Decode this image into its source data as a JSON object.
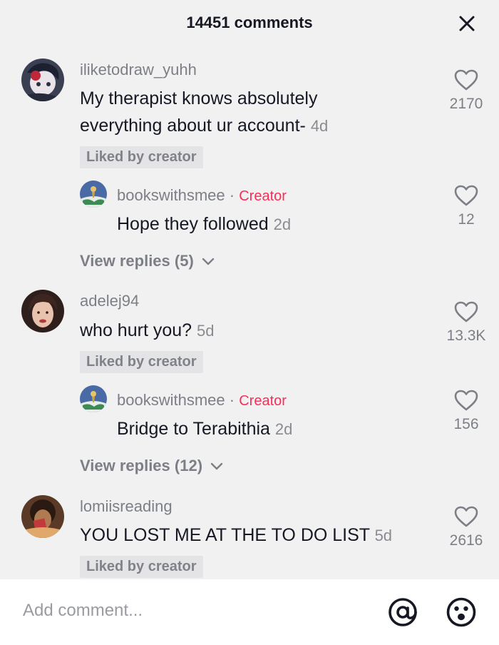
{
  "header": {
    "title": "14451 comments",
    "close_icon": "close-icon"
  },
  "comments": [
    {
      "username": "iliketodraw_yuhh",
      "text_line1": "My therapist knows absolutely",
      "text_line2": "everything about ur account-",
      "time": "4d",
      "liked_by_creator": "Liked by creator",
      "likes": "2170",
      "reply": {
        "username": "bookswithsmee",
        "separator": "·",
        "creator_tag": "Creator",
        "text": "Hope they followed",
        "time": "2d",
        "likes": "12"
      },
      "view_replies": "View replies (5)"
    },
    {
      "username": "adelej94",
      "text": "who hurt you?",
      "time": "5d",
      "liked_by_creator": "Liked by creator",
      "likes": "13.3K",
      "reply": {
        "username": "bookswithsmee",
        "separator": "·",
        "creator_tag": "Creator",
        "text": "Bridge to Terabithia",
        "time": "2d",
        "likes": "156"
      },
      "view_replies": "View replies (12)"
    },
    {
      "username": "lomiisreading",
      "text": "YOU LOST ME AT THE TO DO LIST",
      "time": "5d",
      "liked_by_creator": "Liked by creator",
      "likes": "2616"
    }
  ],
  "input": {
    "placeholder": "Add comment..."
  },
  "colors": {
    "accent": "#fe2c55",
    "background": "#f1f1f2",
    "muted_text": "#7d7f86"
  }
}
